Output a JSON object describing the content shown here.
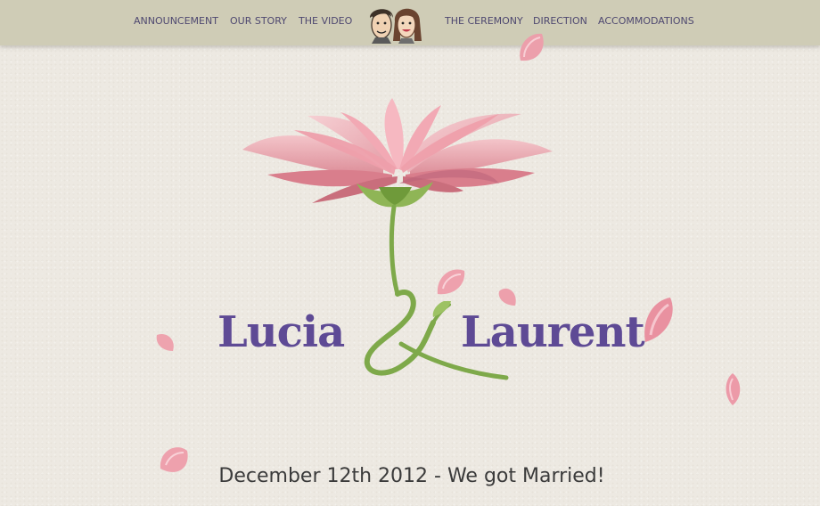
{
  "nav": {
    "left_links": [
      "ANNOUNCEMENT",
      "OUR STORY",
      "THE VIDEO"
    ],
    "right_links": [
      "THE CEREMONY",
      "DIRECTION",
      "ACCOMMODATIONS"
    ],
    "center_icon": "couple-cartoon-avatar"
  },
  "hero": {
    "bride_name": "Lucia",
    "groom_name": "Laurent",
    "ampersand_icon": "flower-stem-ampersand",
    "headline": "December 12th 2012 - We got Married!"
  },
  "colors": {
    "nav_background": "#cfccb6",
    "nav_text": "#4e4870",
    "page_background": "#ede9e2",
    "names": "#5e4a95",
    "petal": "#e8a3ad",
    "stem": "#7ea94a",
    "headline": "#3b3b3b"
  }
}
